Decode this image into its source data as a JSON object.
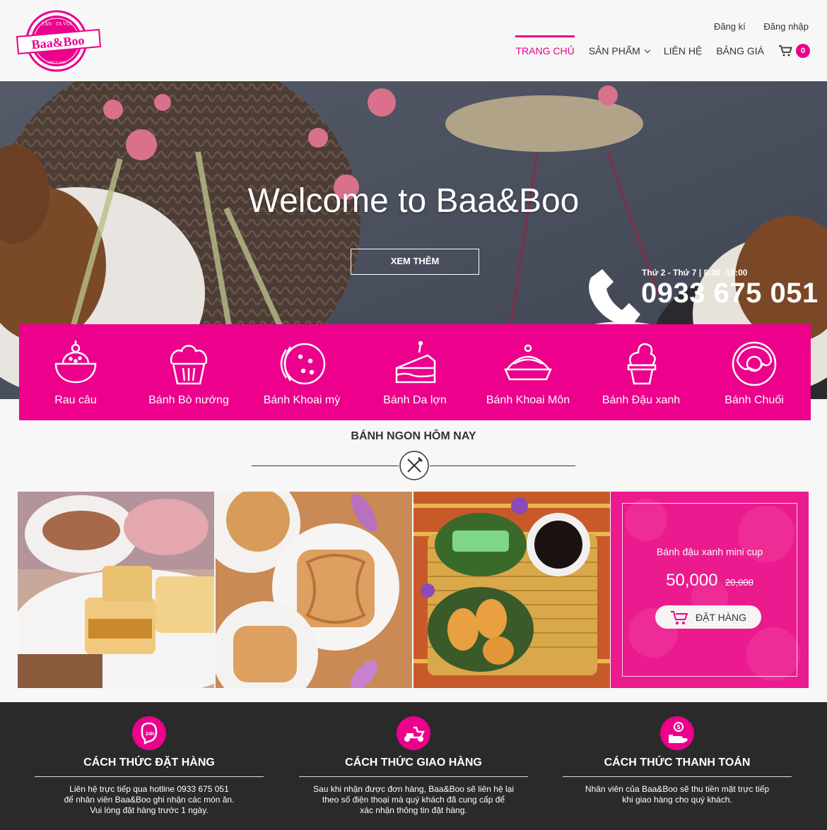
{
  "brand": {
    "logo_text": "Baa&Boo",
    "logo_top": "TẬN · TA VUI",
    "logo_bottom": "SINCE 2009"
  },
  "colors": {
    "accent": "#ec008c",
    "footer_bg": "#2a2a2a"
  },
  "toplinks": {
    "register": "Đăng kí",
    "login": "Đăng nhập"
  },
  "nav": {
    "home": "TRANG CHỦ",
    "products": "SẢN PHẨM",
    "contact": "LIÊN HỆ",
    "prices": "BẢNG GIÁ",
    "cart_count": "0"
  },
  "hero": {
    "title": "Welcome to Baa&Boo",
    "button": "XEM THÊM",
    "hours": "Thứ 2 - Thứ 7 | 8:30 -18:00",
    "phone": "0933 675 051"
  },
  "categories": [
    {
      "label": "Rau câu",
      "icon": "jelly-icon"
    },
    {
      "label": "Bánh Bò nướng",
      "icon": "cupcake-icon"
    },
    {
      "label": "Bánh Khoai mỳ",
      "icon": "cookie-icon"
    },
    {
      "label": "Bánh Da lợn",
      "icon": "cake-slice-icon"
    },
    {
      "label": "Bánh Khoai Môn",
      "icon": "pie-icon"
    },
    {
      "label": "Bánh Đậu xanh",
      "icon": "icecream-icon"
    },
    {
      "label": "Bánh Chuối",
      "icon": "donut-icon"
    }
  ],
  "section": {
    "title": "BÁNH NGON HÔM NAY"
  },
  "promo": {
    "name": "Bánh đậu xanh mini cup",
    "price": "50,000",
    "old_price": "20,000",
    "button": "ĐẶT HÀNG"
  },
  "footer": [
    {
      "title": "CÁCH THỨC ĐẶT HÀNG",
      "icon": "phone-24h-icon",
      "lines": [
        "Liên hệ trực tiếp qua hotline 0933 675 051",
        "để nhân viên Baa&Boo ghi nhận các món ăn.",
        "Vui lòng đặt hàng trước 1 ngày."
      ]
    },
    {
      "title": "CÁCH THỨC GIAO HÀNG",
      "icon": "scooter-icon",
      "lines": [
        "Sau khi nhận được đơn hàng, Baa&Boo sẽ liên hệ lại",
        "theo số điện thoại mà quý khách đã cung cấp để",
        "xác nhận thông tin đặt hàng."
      ]
    },
    {
      "title": "CÁCH THỨC THANH TOÁN",
      "icon": "cash-hand-icon",
      "lines": [
        "Nhân viên của Baa&Boo sẽ thu tiền mặt trực tiếp",
        "khi giao hàng cho quý khách."
      ]
    }
  ]
}
